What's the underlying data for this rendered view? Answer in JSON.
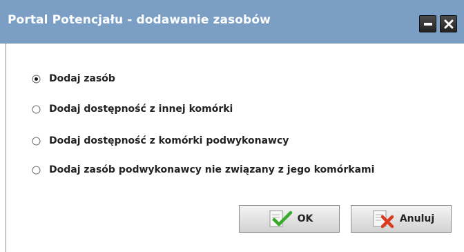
{
  "window": {
    "title": "Portal Potencjału - dodawanie zasobów",
    "minimize_icon": "minimize-icon",
    "close_icon": "close-icon"
  },
  "options": [
    {
      "label": "Dodaj zasób",
      "selected": true
    },
    {
      "label": "Dodaj dostępność z innej komórki",
      "selected": false
    },
    {
      "label": "Dodaj dostępność z komórki podwykonawcy",
      "selected": false
    },
    {
      "label": "Dodaj zasób podwykonawcy nie związany z jego komórkami",
      "selected": false
    }
  ],
  "buttons": {
    "ok_label": "OK",
    "ok_icon": "document-checkmark-icon",
    "cancel_label": "Anuluj",
    "cancel_icon": "document-cross-icon"
  },
  "colors": {
    "titlebar": "#7b9ec4",
    "title_text": "#ffffff",
    "check_green": "#3aa82a",
    "cross_red": "#d93b1f"
  }
}
